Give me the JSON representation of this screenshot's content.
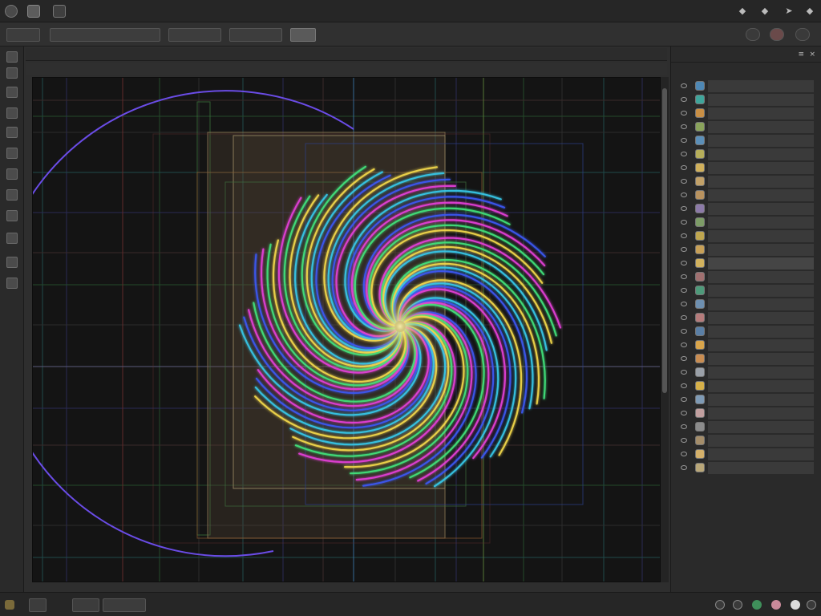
{
  "window": {
    "title": ""
  },
  "toolbar": {
    "buttons": [
      {
        "label": ""
      },
      {
        "label": ""
      },
      {
        "label": ""
      },
      {
        "label": ""
      },
      {
        "label": ""
      }
    ]
  },
  "document": {
    "header_left": "",
    "header_right": "",
    "tab_label": "",
    "viewport_corner_label": "",
    "viewport_bottom_label": ""
  },
  "layers_panel": {
    "title": "",
    "subtitle": "",
    "layers": [
      {
        "name": "",
        "thumb_color": "#4e88b5",
        "fx": ""
      },
      {
        "name": "",
        "thumb_color": "#3fa59b",
        "fx": ""
      },
      {
        "name": "",
        "thumb_color": "#c98f45",
        "fx": ""
      },
      {
        "name": "",
        "thumb_color": "#8aa35b",
        "fx": ""
      },
      {
        "name": "",
        "thumb_color": "#5b8fb8",
        "fx": ""
      },
      {
        "name": "",
        "thumb_color": "#b6ae5a",
        "fx": ""
      },
      {
        "name": "",
        "thumb_color": "#d0b05b",
        "fx": ""
      },
      {
        "name": "",
        "thumb_color": "#c2a168",
        "fx": ""
      },
      {
        "name": "",
        "thumb_color": "#b8925f",
        "fx": ""
      },
      {
        "name": "",
        "thumb_color": "#8c7aa8",
        "fx": ""
      },
      {
        "name": "",
        "thumb_color": "#7d9c67",
        "fx": ""
      },
      {
        "name": "",
        "thumb_color": "#bfa64f",
        "fx": ""
      },
      {
        "name": "",
        "thumb_color": "#c7a057",
        "fx": ""
      },
      {
        "name": "",
        "thumb_color": "#d2b25e",
        "fx": ""
      },
      {
        "name": "",
        "thumb_color": "#a07070",
        "fx": ""
      },
      {
        "name": "",
        "thumb_color": "#4e9a7a",
        "fx": ""
      },
      {
        "name": "",
        "thumb_color": "#6d8fb0",
        "fx": ""
      },
      {
        "name": "",
        "thumb_color": "#b57b7b",
        "fx": ""
      },
      {
        "name": "",
        "thumb_color": "#5a7fa6",
        "fx": ""
      },
      {
        "name": "",
        "thumb_color": "#d9a54b",
        "fx": ""
      },
      {
        "name": "",
        "thumb_color": "#c98d52",
        "fx": ""
      },
      {
        "name": "",
        "thumb_color": "#9aa0a8",
        "fx": ""
      },
      {
        "name": "",
        "thumb_color": "#d6b049",
        "fx": ""
      },
      {
        "name": "",
        "thumb_color": "#7e9ab5",
        "fx": ""
      },
      {
        "name": "",
        "thumb_color": "#c2a0a0",
        "fx": ""
      },
      {
        "name": "",
        "thumb_color": "#8c8c8c",
        "fx": ""
      },
      {
        "name": "",
        "thumb_color": "#a48d6a",
        "fx": ""
      },
      {
        "name": "",
        "thumb_color": "#d4b06a",
        "fx": ""
      },
      {
        "name": "",
        "thumb_color": "#b9a779",
        "fx": ""
      }
    ],
    "selected_index": 13
  },
  "status_bar": {
    "zoom_label": "",
    "buttons": [
      {
        "label": ""
      },
      {
        "label": ""
      }
    ]
  },
  "colors": {
    "viewport_bg": "#141414",
    "panel_bg": "#2a2a2a",
    "accent_spiral": [
      "#f0d64a",
      "#36c6e6",
      "#3b56f0",
      "#e23fd6",
      "#41e07a"
    ]
  },
  "icons": {
    "app": "app-logo-icon",
    "window_controls": [
      "minimize-icon",
      "maximize-icon",
      "pin-icon",
      "close-icon"
    ],
    "left_tools": [
      "move-tool-icon",
      "select-tool-icon",
      "lasso-tool-icon",
      "crop-tool-icon",
      "brush-tool-icon",
      "eraser-tool-icon",
      "stamp-tool-icon",
      "gradient-tool-icon",
      "pen-tool-icon",
      "text-tool-icon",
      "shape-tool-icon",
      "zoom-tool-icon"
    ]
  }
}
